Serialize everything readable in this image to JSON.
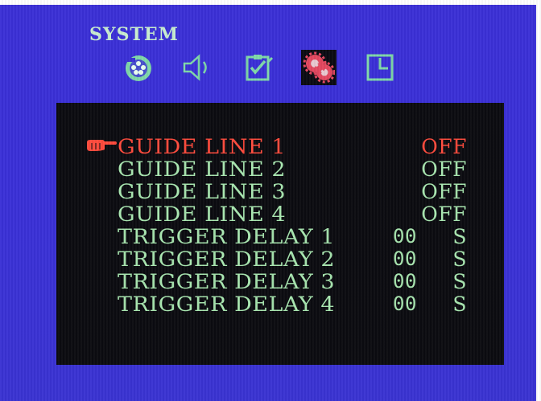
{
  "header": {
    "title": "SYSTEM"
  },
  "tabs": [
    {
      "icon": "film-reel-icon",
      "selected": false
    },
    {
      "icon": "speaker-icon",
      "selected": false
    },
    {
      "icon": "checklist-icon",
      "selected": false
    },
    {
      "icon": "gears-icon",
      "selected": true
    },
    {
      "icon": "clock-icon",
      "selected": false
    }
  ],
  "menu": {
    "items": [
      {
        "label": "GUIDE LINE 1",
        "value": "OFF",
        "active": true
      },
      {
        "label": "GUIDE LINE 2",
        "value": "OFF"
      },
      {
        "label": "GUIDE LINE 3",
        "value": "OFF"
      },
      {
        "label": "GUIDE LINE 4",
        "value": "OFF"
      },
      {
        "label": "TRIGGER DELAY 1",
        "value": "00",
        "unit": "S"
      },
      {
        "label": "TRIGGER DELAY 2",
        "value": "00",
        "unit": "S"
      },
      {
        "label": "TRIGGER DELAY 3",
        "value": "00",
        "unit": "S"
      },
      {
        "label": "TRIGGER DELAY 4",
        "value": "00",
        "unit": "S"
      }
    ]
  },
  "colors": {
    "background": "#3b2fd6",
    "panel": "#0b0b10",
    "text": "#a8e6b0",
    "active": "#ff4a3c",
    "icon": "#7fd8a8"
  }
}
